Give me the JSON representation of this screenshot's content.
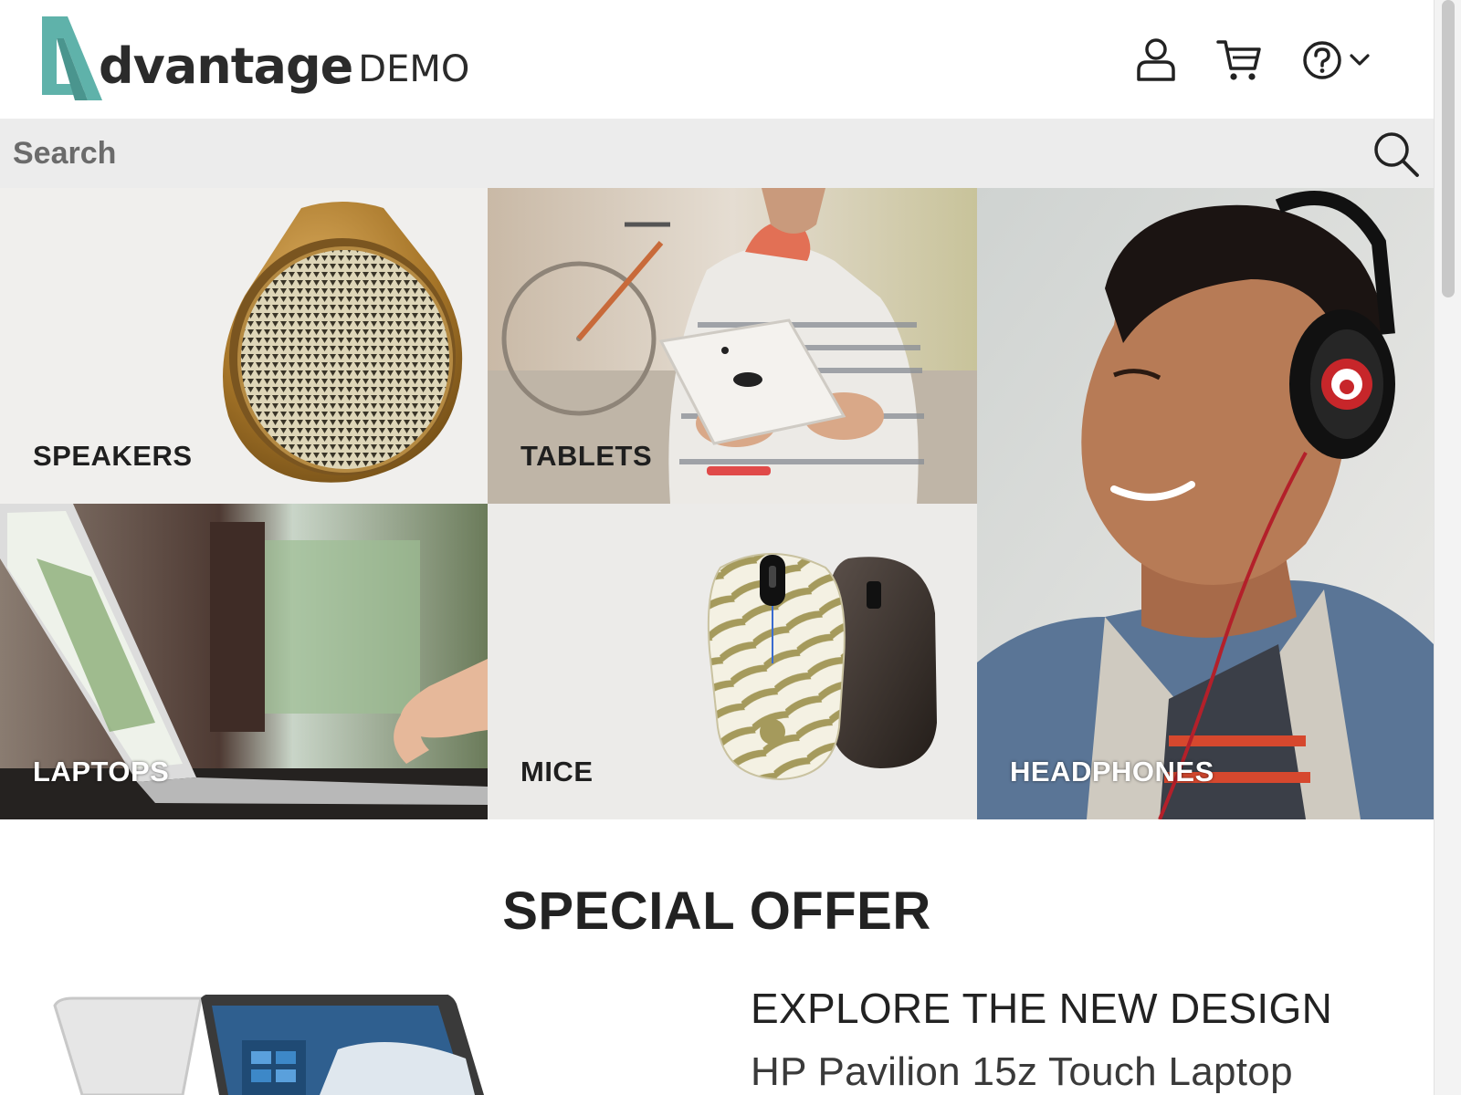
{
  "brand": {
    "name": "dvantage",
    "suffix": "DEMO",
    "accent_color": "#5fb2aa"
  },
  "header": {
    "icons": [
      "user-icon",
      "cart-icon",
      "help-icon",
      "chevron-down-icon"
    ]
  },
  "search": {
    "placeholder": "Search",
    "icon": "search-icon"
  },
  "categories": [
    {
      "id": "speakers",
      "label": "SPEAKERS"
    },
    {
      "id": "tablets",
      "label": "TABLETS"
    },
    {
      "id": "laptops",
      "label": "LAPTOPS"
    },
    {
      "id": "mice",
      "label": "MICE"
    },
    {
      "id": "headphones",
      "label": "HEADPHONES"
    }
  ],
  "special_offer": {
    "title": "SPECIAL OFFER",
    "subtitle": "EXPLORE THE NEW DESIGN",
    "product": "HP Pavilion 15z Touch Laptop"
  }
}
